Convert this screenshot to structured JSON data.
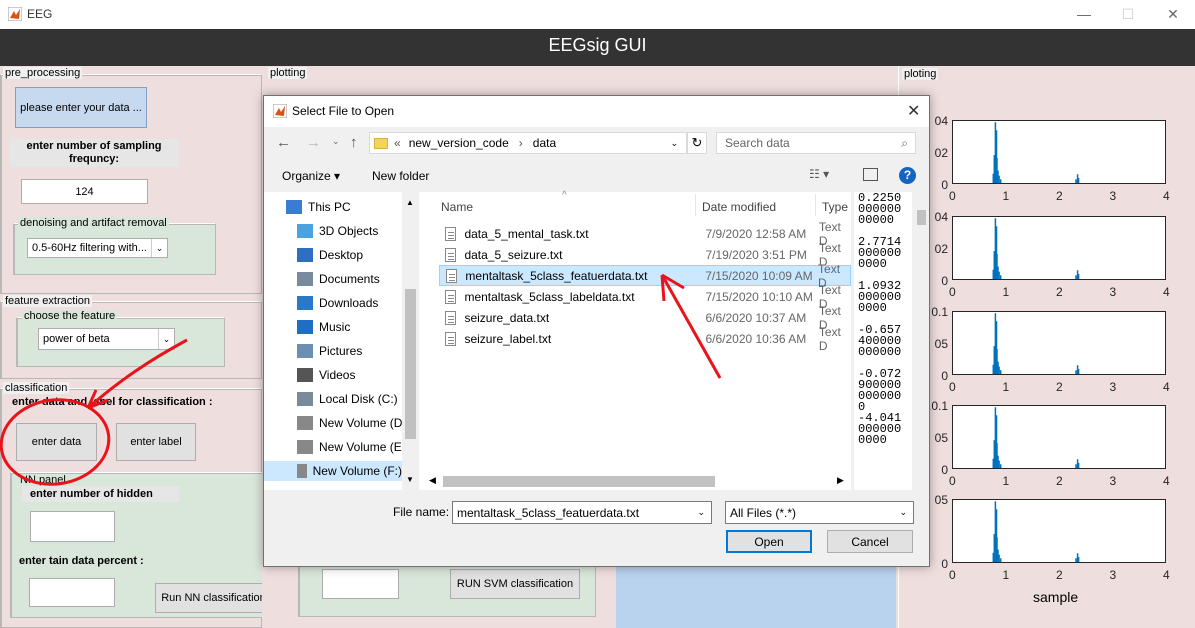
{
  "window": {
    "title": "EEG",
    "controls": [
      "—",
      "☐",
      "✕"
    ]
  },
  "header": {
    "title": "EEGsig GUI"
  },
  "preprocessing": {
    "label": "pre_processing",
    "enter_data_button": "please enter your data ...",
    "sampling_label": "enter number of sampling frequncy:",
    "sampling_value": "124",
    "denoise_label": "denoising and artifact removal",
    "denoise_value": "0.5-60Hz filtering with..."
  },
  "feature": {
    "label": "feature extraction",
    "choose_label": "choose the feature",
    "choose_value": "power of beta"
  },
  "classification": {
    "label": "classification",
    "instruction": "enter data and label for classification :",
    "enter_data_button": "enter data",
    "enter_label_button": "enter label"
  },
  "nn": {
    "label": "NN panel",
    "hidden_label": "enter number of hidden",
    "train_label": "enter tain data percent :",
    "run_button": "Run NN classification"
  },
  "svm": {
    "run_button": "RUN SVM classification"
  },
  "plotting": {
    "label": "plotting"
  },
  "right_plotting": {
    "label": "ploting",
    "xlabel": "sample",
    "xticks": [
      "0",
      "1",
      "2",
      "3",
      "4"
    ],
    "ytick_labels": [
      [
        "04",
        "02",
        "0"
      ],
      [
        "04",
        "02",
        "0"
      ],
      [
        "0.1",
        "05",
        "0"
      ],
      [
        ".0.1",
        "05",
        "0"
      ],
      [
        "05",
        "0"
      ]
    ]
  },
  "dialog": {
    "title": "Select File to Open",
    "path": [
      "«",
      "new_version_code",
      "›",
      "data"
    ],
    "search_placeholder": "Search data",
    "organize": "Organize ▾",
    "new_folder": "New folder",
    "columns": {
      "name": "Name",
      "date": "Date modified",
      "type": "Type"
    },
    "nav_items": [
      {
        "label": "This PC",
        "icon": "computer-icon"
      },
      {
        "label": "3D Objects",
        "icon": "cube-icon"
      },
      {
        "label": "Desktop",
        "icon": "desktop-icon"
      },
      {
        "label": "Documents",
        "icon": "documents-icon"
      },
      {
        "label": "Downloads",
        "icon": "download-icon"
      },
      {
        "label": "Music",
        "icon": "music-icon"
      },
      {
        "label": "Pictures",
        "icon": "pictures-icon"
      },
      {
        "label": "Videos",
        "icon": "videos-icon"
      },
      {
        "label": "Local Disk (C:)",
        "icon": "disk-icon"
      },
      {
        "label": "New Volume (D:",
        "icon": "drive-icon"
      },
      {
        "label": "New Volume (E:)",
        "icon": "drive-icon"
      },
      {
        "label": "New Volume (F:)",
        "icon": "drive-icon"
      }
    ],
    "files": [
      {
        "name": "data_5_mental_task.txt",
        "date": "7/9/2020 12:58 AM",
        "type": "Text D"
      },
      {
        "name": "data_5_seizure.txt",
        "date": "7/19/2020 3:51 PM",
        "type": "Text D"
      },
      {
        "name": "mentaltask_5class_featuerdata.txt",
        "date": "7/15/2020 10:09 AM",
        "type": "Text D"
      },
      {
        "name": "mentaltask_5class_labeldata.txt",
        "date": "7/15/2020 10:10 AM",
        "type": "Text D"
      },
      {
        "name": "seizure_data.txt",
        "date": "6/6/2020 10:37 AM",
        "type": "Text D"
      },
      {
        "name": "seizure_label.txt",
        "date": "6/6/2020 10:36 AM",
        "type": "Text D"
      }
    ],
    "preview_lines": [
      "0.2250",
      "000000",
      "00000",
      "",
      "2.7714",
      "000000",
      "0000",
      "",
      "1.0932",
      "000000",
      "0000",
      "",
      "-0.657",
      "400000",
      "000000",
      "",
      "-0.072",
      "900000",
      "000000",
      "0",
      "-4.041",
      "000000",
      "0000"
    ],
    "file_name_label": "File name:",
    "file_name_value": "mentaltask_5class_featuerdata.txt",
    "filter_value": "All Files (*.*)",
    "open_button": "Open",
    "cancel_button": "Cancel"
  },
  "colors": {
    "header_bg": "#333333",
    "panel_pink": "#efdede",
    "panel_green": "#d9e6da",
    "selected_row": "#cce8ff",
    "annotation_red": "#e8141c",
    "plot_blue": "#0072bd"
  }
}
